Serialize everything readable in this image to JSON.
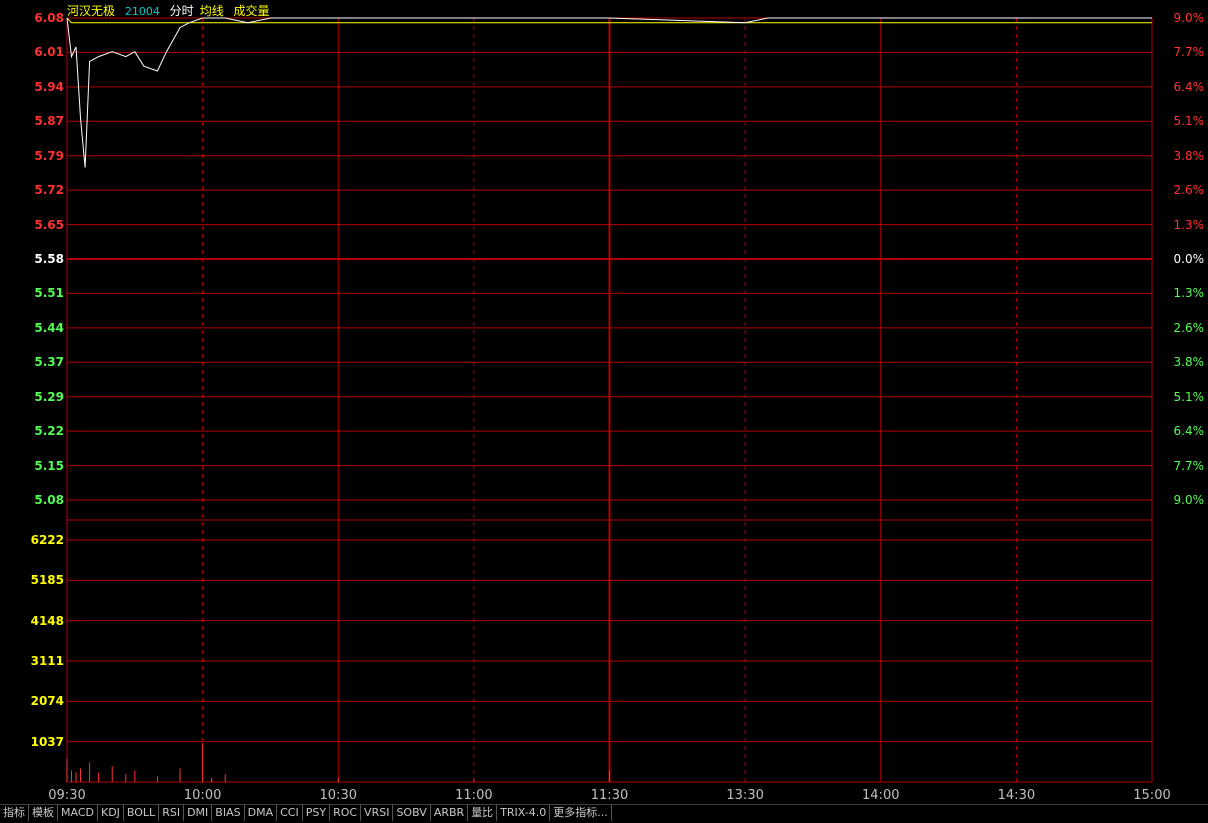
{
  "header": {
    "name": "河汉无极",
    "code": "21004",
    "label_fenshi": "分时",
    "label_junxian": "均线",
    "label_volume": "成交量"
  },
  "colors": {
    "grid": "#b40000",
    "up": "#ff3232",
    "down": "#54fc54",
    "neutral": "#ffffff",
    "volume_axis": "#ffff00",
    "price_line": "#ffffff",
    "avg_line": "#ffff00",
    "volume_bar": "#ff3232"
  },
  "chart_data": [
    {
      "type": "line",
      "title": "分时",
      "x_ticks": [
        "09:30",
        "10:00",
        "10:30",
        "11:00",
        "11:30",
        "13:30",
        "14:00",
        "14:30",
        "15:00"
      ],
      "x": [
        "09:30",
        "09:31",
        "09:32",
        "09:33",
        "09:34",
        "09:35",
        "09:37",
        "09:40",
        "09:43",
        "09:45",
        "09:47",
        "09:50",
        "09:52",
        "09:55",
        "09:57",
        "10:00",
        "10:05",
        "10:10",
        "10:15",
        "10:20",
        "10:30",
        "11:00",
        "11:30",
        "13:30",
        "13:35",
        "13:40",
        "13:45",
        "13:50",
        "14:00",
        "14:30",
        "15:00"
      ],
      "series": [
        {
          "values": [
            6.08,
            6.0,
            6.02,
            5.87,
            5.77,
            5.99,
            6.0,
            6.01,
            6.0,
            6.01,
            5.98,
            5.97,
            6.01,
            6.06,
            6.07,
            6.08,
            6.08,
            6.07,
            6.08,
            6.08,
            6.08,
            6.08,
            6.08,
            6.07,
            6.08,
            6.08,
            6.08,
            6.08,
            6.08,
            6.08,
            6.08
          ]
        },
        {
          "values": [
            6.08,
            6.07,
            6.07,
            6.07,
            6.07,
            6.07,
            6.07,
            6.07,
            6.07,
            6.07,
            6.07,
            6.07,
            6.07,
            6.07,
            6.07,
            6.07,
            6.07,
            6.07,
            6.07,
            6.07,
            6.07,
            6.07,
            6.07,
            6.07,
            6.07,
            6.07,
            6.07,
            6.07,
            6.07,
            6.07,
            6.07
          ]
        }
      ],
      "y_ticks_left": [
        "6.08",
        "6.01",
        "5.94",
        "5.87",
        "5.79",
        "5.72",
        "5.65",
        "5.58",
        "5.51",
        "5.44",
        "5.37",
        "5.29",
        "5.22",
        "5.15",
        "5.08"
      ],
      "y_ticks_right": [
        "9.0%",
        "7.7%",
        "6.4%",
        "5.1%",
        "3.8%",
        "2.6%",
        "1.3%",
        "0.0%",
        "1.3%",
        "2.6%",
        "3.8%",
        "5.1%",
        "6.4%",
        "7.7%",
        "9.0%"
      ],
      "ylim": [
        5.08,
        6.08
      ],
      "grid": true
    },
    {
      "type": "bar",
      "title": "成交量",
      "x": [
        "09:30",
        "09:31",
        "09:32",
        "09:33",
        "09:35",
        "09:37",
        "09:40",
        "09:43",
        "09:45",
        "09:50",
        "09:55",
        "10:00",
        "10:02",
        "10:05",
        "10:30",
        "11:00",
        "11:30",
        "11:32"
      ],
      "values": [
        600,
        300,
        250,
        350,
        500,
        250,
        400,
        200,
        300,
        150,
        350,
        1000,
        100,
        200,
        100,
        80,
        300,
        100
      ],
      "y_ticks": [
        "6222",
        "5185",
        "4148",
        "3111",
        "2074",
        "1037"
      ],
      "ylim": [
        0,
        6222
      ],
      "grid": true
    }
  ],
  "tabs": [
    "指标",
    "模板",
    "MACD",
    "KDJ",
    "BOLL",
    "RSI",
    "DMI",
    "BIAS",
    "DMA",
    "CCI",
    "PSY",
    "ROC",
    "VRSI",
    "SOBV",
    "ARBR",
    "量比",
    "TRIX-4.0",
    "更多指标..."
  ]
}
